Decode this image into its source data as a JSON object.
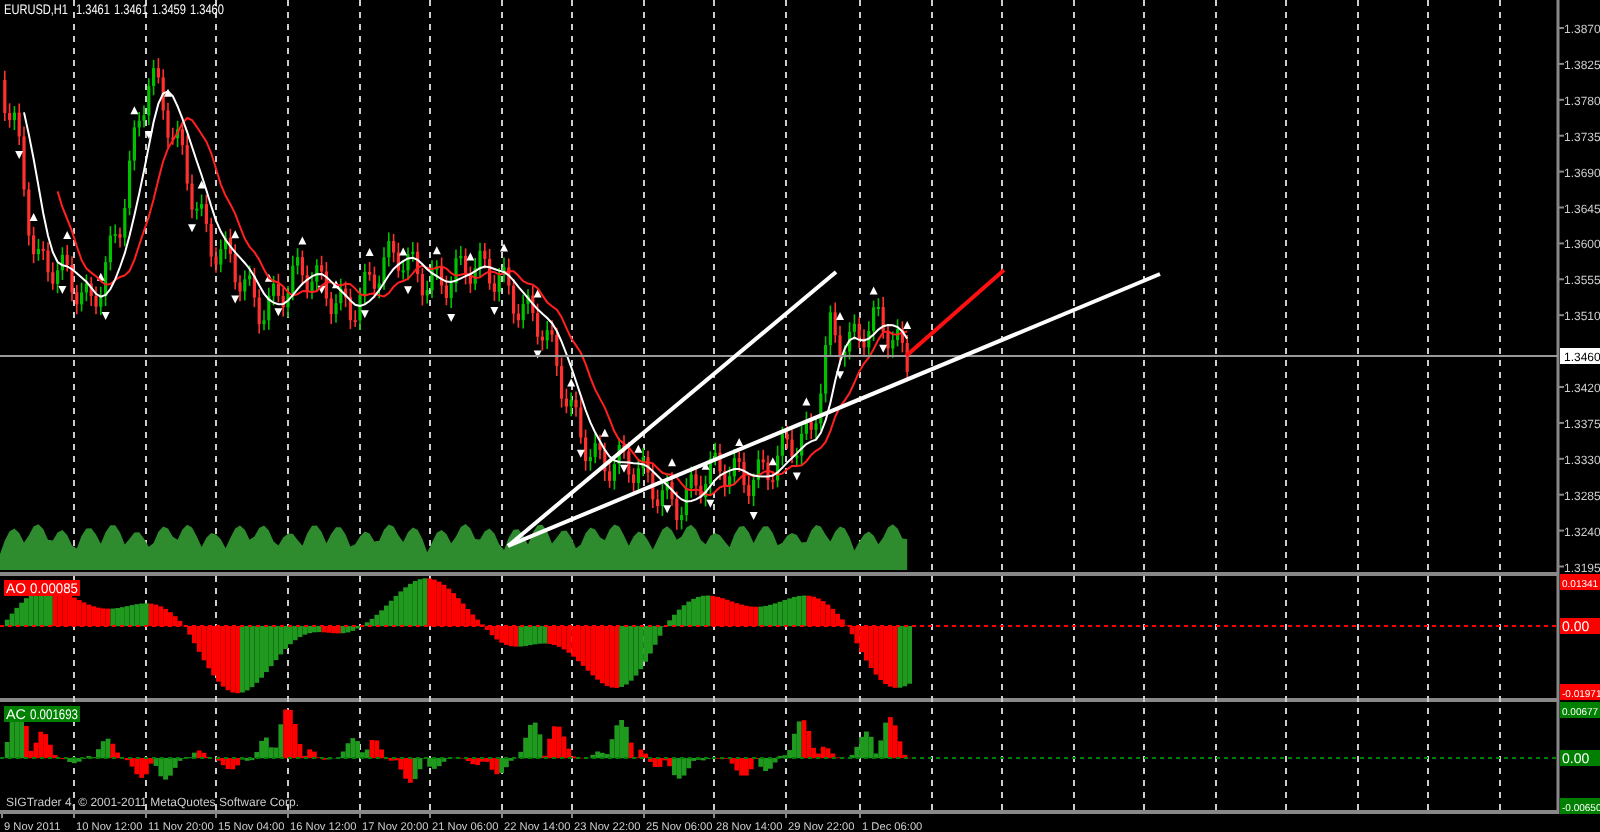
{
  "chart": {
    "symbol": "EURUSD,H1",
    "quotes": [
      "1.3461",
      "1.3461",
      "1.3459",
      "1.3460"
    ],
    "price_axis": [
      "1.3870",
      "1.3825",
      "1.3780",
      "1.3735",
      "1.3690",
      "1.3645",
      "1.3600",
      "1.3555",
      "1.3510",
      "1.3420",
      "1.3375",
      "1.3330",
      "1.3285",
      "1.3240",
      "1.3195"
    ],
    "current_price": "1.3460"
  },
  "indicators": [
    {
      "name": "AO",
      "value": "0.00085",
      "color": "#ff0000",
      "axis": [
        "0.01341",
        "0.00",
        "-0.01971"
      ]
    },
    {
      "name": "AC",
      "value": "0.001693",
      "color": "#008000",
      "axis": [
        "0.00677",
        "0.00",
        "-0.00650"
      ]
    }
  ],
  "copyright": "SIGTrader 4, © 2001-2011 MetaQuotes Software Corp.",
  "time_axis": [
    "9 Nov 2011",
    "10 Nov 12:00",
    "11 Nov 20:00",
    "15 Nov 04:00",
    "16 Nov 12:00",
    "17 Nov 20:00",
    "21 Nov 06:00",
    "22 Nov 14:00",
    "23 Nov 22:00",
    "25 Nov 06:00",
    "28 Nov 14:00",
    "29 Nov 22:00",
    "1 Dec 06:00"
  ]
}
